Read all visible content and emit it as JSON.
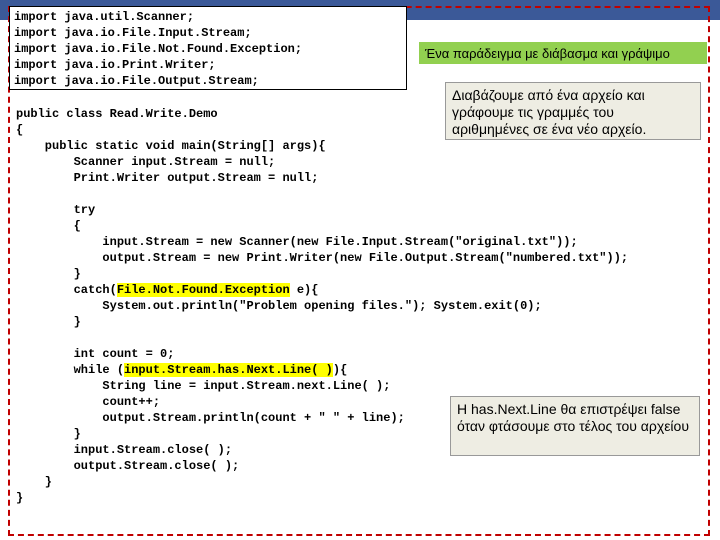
{
  "imports": "import java.util.Scanner;\nimport java.io.File.Input.Stream;\nimport java.io.File.Not.Found.Exception;\nimport java.io.Print.Writer;\nimport java.io.File.Output.Stream;",
  "code_part1": "\n\n\n\n\n\npublic class Read.Write.Demo\n{\n    public static void main(String[] args){\n        Scanner input.Stream = null;\n        Print.Writer output.Stream = null;\n\n        try\n        {\n            input.Stream = new Scanner(new File.Input.Stream(\"original.txt\"));\n            output.Stream = new Print.Writer(new File.Output.Stream(\"numbered.txt\"));\n        }\n        catch(",
  "code_hl1": "File.Not.Found.Exception",
  "code_part2": " e){\n            System.out.println(\"Problem opening files.\"); System.exit(0);\n        }\n\n        int count = 0;\n        while (",
  "code_hl2": "input.Stream.has.Next.Line( )",
  "code_part3": "){\n            String line = input.Stream.next.Line( );\n            count++;\n            output.Stream.println(count + \" \" + line);\n        }\n        input.Stream.close( );\n        output.Stream.close( );\n    }\n}",
  "box1": "Ένα παράδειγμα με διάβασμα και γράψιμο",
  "box2": "Διαβάζουμε από ένα αρχείο και γράφουμε τις γραμμές του αριθμημένες σε ένα νέο αρχείο.",
  "box3": "H has.Next.Line θα επιστρέψει false όταν φτάσουμε στο τέλος του αρχείου"
}
